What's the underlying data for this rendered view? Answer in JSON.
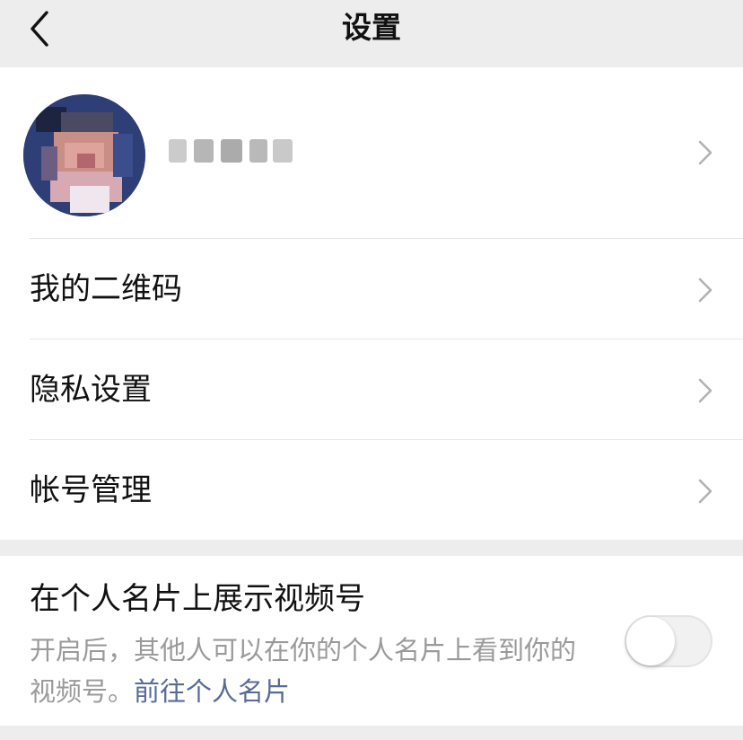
{
  "header": {
    "title": "设置",
    "back_icon": "chevron-left-icon"
  },
  "profile": {
    "avatar_icon": "avatar-blurred",
    "name": "",
    "chevron_icon": "chevron-right-icon"
  },
  "menu": {
    "items": [
      {
        "label": "我的二维码",
        "icon": "chevron-right-icon"
      },
      {
        "label": "隐私设置",
        "icon": "chevron-right-icon"
      },
      {
        "label": "帐号管理",
        "icon": "chevron-right-icon"
      }
    ]
  },
  "channel_setting": {
    "title": "在个人名片上展示视频号",
    "description": "开启后，其他人可以在你的个人名片上看到你的视频号。",
    "link_text": "前往个人名片",
    "toggle_on": false
  },
  "colors": {
    "background": "#ededed",
    "card": "#ffffff",
    "primary_text": "#111111",
    "secondary_text": "#9a9a9a",
    "link": "#576b95",
    "divider": "#e5e5e5",
    "chevron": "#b2b2b2"
  }
}
